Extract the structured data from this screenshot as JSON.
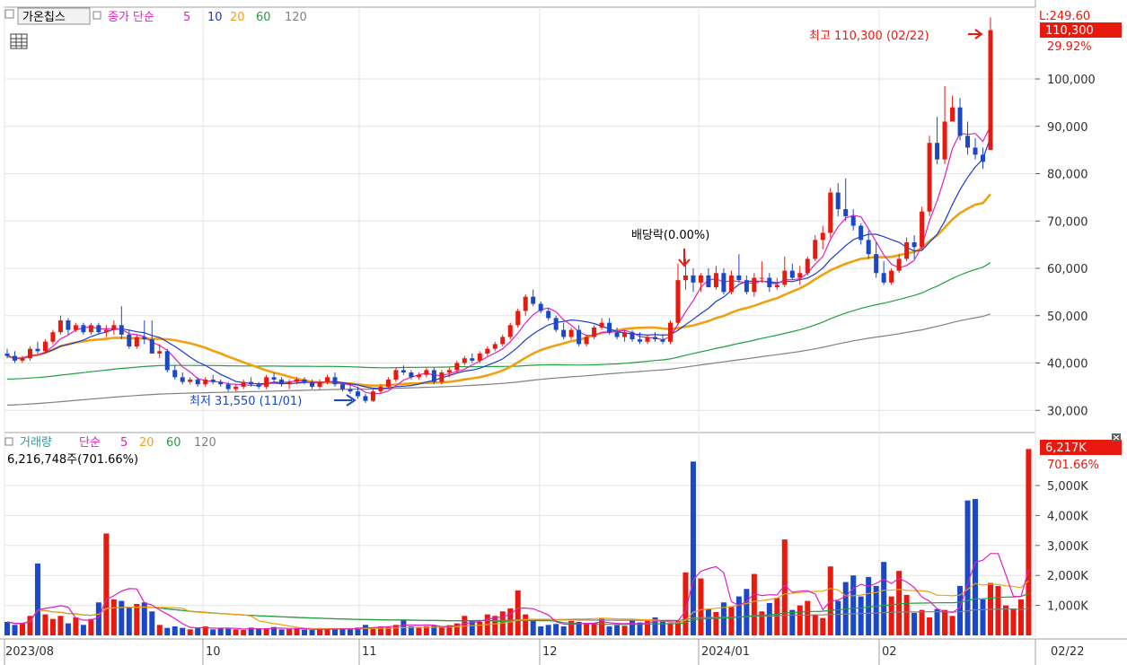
{
  "stock": {
    "name": "가온칩스",
    "ma_label": "종가 단순",
    "ma_periods": [
      "5",
      "10",
      "20",
      "60",
      "120"
    ]
  },
  "volume_panel": {
    "title": "거래량",
    "ma_label": "단순",
    "ma_periods": [
      "5",
      "20",
      "60",
      "120"
    ],
    "info": "6,216,748주(701.66%)"
  },
  "price_axis": {
    "ticks": [
      "100,000",
      "90,000",
      "80,000",
      "70,000",
      "60,000",
      "50,000",
      "40,000",
      "30,000"
    ],
    "top_partial": "L:249.60",
    "current_price": "110,300",
    "change_pct": "29.92%"
  },
  "volume_axis": {
    "ticks": [
      "5,000K",
      "4,000K",
      "3,000K",
      "2,000K",
      "1,000K"
    ],
    "current": "6,217K",
    "current_pct": "701.66%"
  },
  "x_axis": {
    "labels": [
      "2023/08",
      "10",
      "11",
      "12",
      "2024/01",
      "02"
    ],
    "last_date": "02/22"
  },
  "annotations": {
    "high": "최고 110,300 (02/22)",
    "low": "최저 31,550 (11/01)",
    "dividend": "배당락(0.00%)"
  },
  "colors": {
    "up": "#e8190f",
    "down": "#1a48c8",
    "ma5": "#e020c0",
    "ma10": "#1a3ad0",
    "ma20": "#f0a010",
    "ma60": "#20a040",
    "ma120": "#808080"
  },
  "chart_data": [
    {
      "type": "candlestick",
      "title": "가온칩스",
      "y_ticks": [
        30000,
        40000,
        50000,
        60000,
        70000,
        80000,
        90000,
        100000
      ],
      "ylim": [
        25000,
        113000
      ],
      "high": {
        "date": "02/22",
        "value": 110300
      },
      "low": {
        "date": "11/01",
        "value": 31550
      },
      "ohlc": [
        [
          42000,
          43000,
          41000,
          41500
        ],
        [
          41500,
          42500,
          40000,
          40500
        ],
        [
          40500,
          41500,
          40000,
          41000
        ],
        [
          41000,
          43500,
          40500,
          43000
        ],
        [
          43000,
          44500,
          42000,
          42500
        ],
        [
          42500,
          45000,
          42000,
          44500
        ],
        [
          44500,
          47000,
          44000,
          46500
        ],
        [
          46500,
          50000,
          46000,
          49000
        ],
        [
          49000,
          49500,
          46000,
          47000
        ],
        [
          47000,
          48500,
          46500,
          48000
        ],
        [
          48000,
          48500,
          46000,
          46500
        ],
        [
          46500,
          48500,
          46000,
          48000
        ],
        [
          48000,
          48500,
          46000,
          46500
        ],
        [
          46500,
          48000,
          45500,
          47000
        ],
        [
          47000,
          49000,
          46000,
          48000
        ],
        [
          48000,
          52000,
          45000,
          46000
        ],
        [
          46000,
          47000,
          43000,
          43500
        ],
        [
          43500,
          46000,
          43000,
          45500
        ],
        [
          45500,
          49000,
          44000,
          45000
        ],
        [
          45000,
          49000,
          44500,
          42000
        ],
        [
          42000,
          44000,
          41000,
          42500
        ],
        [
          42500,
          43000,
          38000,
          38500
        ],
        [
          38500,
          39500,
          36500,
          37000
        ],
        [
          37000,
          38000,
          35500,
          36000
        ],
        [
          36000,
          37000,
          35500,
          36500
        ],
        [
          36500,
          37000,
          35000,
          35500
        ],
        [
          35500,
          37000,
          35000,
          36500
        ],
        [
          36500,
          37500,
          35500,
          36000
        ],
        [
          36000,
          36500,
          35000,
          35500
        ],
        [
          35500,
          36000,
          34000,
          34500
        ],
        [
          34500,
          35500,
          34000,
          35000
        ],
        [
          35000,
          36500,
          34500,
          36000
        ],
        [
          36000,
          37000,
          35000,
          35500
        ],
        [
          35500,
          36000,
          34500,
          35000
        ],
        [
          35000,
          37500,
          34500,
          37000
        ],
        [
          37000,
          38000,
          36000,
          36500
        ],
        [
          36500,
          37000,
          35000,
          35500
        ],
        [
          35500,
          36500,
          34500,
          36000
        ],
        [
          36000,
          37000,
          35500,
          36500
        ],
        [
          36500,
          37000,
          35500,
          36000
        ],
        [
          36000,
          36500,
          34500,
          35000
        ],
        [
          35000,
          36500,
          34500,
          36000
        ],
        [
          36000,
          37500,
          35500,
          37000
        ],
        [
          37000,
          38000,
          35000,
          35500
        ],
        [
          35500,
          36000,
          34000,
          34500
        ],
        [
          34500,
          35500,
          33500,
          34000
        ],
        [
          34000,
          35000,
          32500,
          33000
        ],
        [
          33000,
          33500,
          31550,
          32000
        ],
        [
          32000,
          34500,
          31800,
          34000
        ],
        [
          34000,
          35500,
          33500,
          35000
        ],
        [
          35000,
          37000,
          34500,
          36500
        ],
        [
          36500,
          39000,
          36000,
          38500
        ],
        [
          38500,
          39500,
          37500,
          38000
        ],
        [
          38000,
          38500,
          36500,
          37000
        ],
        [
          37000,
          38000,
          36500,
          37500
        ],
        [
          37500,
          39000,
          37000,
          38500
        ],
        [
          38500,
          39000,
          35500,
          36000
        ],
        [
          36000,
          38500,
          35500,
          38000
        ],
        [
          38000,
          39000,
          37000,
          38500
        ],
        [
          38500,
          40500,
          38000,
          40000
        ],
        [
          40000,
          41500,
          39500,
          41000
        ],
        [
          41000,
          42000,
          40000,
          40500
        ],
        [
          40500,
          42500,
          40000,
          42000
        ],
        [
          42000,
          43500,
          41500,
          43000
        ],
        [
          43000,
          44500,
          42500,
          44000
        ],
        [
          44000,
          46000,
          43500,
          45500
        ],
        [
          45500,
          48500,
          45000,
          48000
        ],
        [
          48000,
          51500,
          47500,
          51000
        ],
        [
          51000,
          54500,
          50000,
          54000
        ],
        [
          54000,
          55500,
          52000,
          52500
        ],
        [
          52500,
          53000,
          50500,
          51000
        ],
        [
          51000,
          51500,
          49000,
          49500
        ],
        [
          49500,
          50000,
          46500,
          47000
        ],
        [
          47000,
          48500,
          45000,
          45500
        ],
        [
          45500,
          47500,
          45000,
          47000
        ],
        [
          47000,
          48000,
          43500,
          44000
        ],
        [
          44000,
          46000,
          43500,
          45500
        ],
        [
          45500,
          48000,
          45000,
          47500
        ],
        [
          47500,
          49500,
          47000,
          48500
        ],
        [
          48500,
          49500,
          46000,
          46500
        ],
        [
          46500,
          47500,
          45000,
          45500
        ],
        [
          45500,
          47000,
          44500,
          46500
        ],
        [
          46500,
          47000,
          44500,
          45000
        ],
        [
          45000,
          46500,
          44000,
          44500
        ],
        [
          44500,
          46000,
          44000,
          45500
        ],
        [
          45500,
          46500,
          44500,
          45000
        ],
        [
          45000,
          46000,
          44000,
          44500
        ],
        [
          44500,
          49000,
          44000,
          48500
        ],
        [
          48500,
          61000,
          48000,
          57500
        ],
        [
          57500,
          62000,
          55500,
          58500
        ],
        [
          58500,
          60000,
          55000,
          57000
        ],
        [
          57000,
          59000,
          55000,
          58500
        ],
        [
          58500,
          60000,
          56000,
          56000
        ],
        [
          56000,
          60500,
          55500,
          59000
        ],
        [
          59000,
          60000,
          54500,
          55000
        ],
        [
          55000,
          59500,
          54500,
          58500
        ],
        [
          58500,
          63000,
          57000,
          57500
        ],
        [
          57500,
          58500,
          54500,
          55000
        ],
        [
          55000,
          59000,
          54000,
          58000
        ],
        [
          58000,
          61500,
          57000,
          58000
        ],
        [
          58000,
          59000,
          55000,
          56000
        ],
        [
          56000,
          58000,
          55500,
          56500
        ],
        [
          56500,
          62500,
          56000,
          59500
        ],
        [
          59500,
          61000,
          57500,
          58000
        ],
        [
          58000,
          60500,
          56500,
          59000
        ],
        [
          59000,
          62500,
          58500,
          62000
        ],
        [
          62000,
          67000,
          61500,
          66000
        ],
        [
          66000,
          69000,
          64000,
          67500
        ],
        [
          67500,
          77000,
          66500,
          76000
        ],
        [
          76000,
          78000,
          71000,
          72500
        ],
        [
          72500,
          79000,
          70000,
          71000
        ],
        [
          71000,
          72500,
          68000,
          69000
        ],
        [
          69000,
          69500,
          65000,
          66000
        ],
        [
          66000,
          68000,
          62000,
          63000
        ],
        [
          63000,
          65500,
          58000,
          59000
        ],
        [
          59000,
          61500,
          56500,
          57000
        ],
        [
          57000,
          60000,
          56500,
          59500
        ],
        [
          59500,
          63000,
          59000,
          62000
        ],
        [
          62000,
          66500,
          61500,
          65500
        ],
        [
          65500,
          67000,
          62000,
          64500
        ],
        [
          64500,
          73000,
          64000,
          72000
        ],
        [
          72000,
          88000,
          71000,
          86500
        ],
        [
          86500,
          92000,
          82000,
          83000
        ],
        [
          83000,
          98500,
          82000,
          91000
        ],
        [
          91000,
          96500,
          91000,
          94000
        ],
        [
          94000,
          96000,
          87000,
          88000
        ],
        [
          88000,
          91000,
          84000,
          85500
        ],
        [
          85500,
          87500,
          83000,
          84000
        ],
        [
          84000,
          85500,
          81000,
          82500
        ],
        [
          85000,
          113000,
          85000,
          110300
        ]
      ]
    },
    {
      "type": "bar",
      "title": "거래량",
      "y_ticks": [
        1000,
        2000,
        3000,
        4000,
        5000
      ],
      "y_unit": "K",
      "ylim": [
        0,
        6400
      ],
      "latest": {
        "value": 6216748,
        "pct": 701.66
      },
      "values_k": [
        450,
        350,
        400,
        650,
        2400,
        700,
        550,
        650,
        400,
        600,
        350,
        550,
        1100,
        3400,
        1200,
        1150,
        950,
        1050,
        1100,
        800,
        350,
        250,
        300,
        250,
        200,
        250,
        300,
        200,
        250,
        220,
        200,
        180,
        260,
        230,
        240,
        280,
        200,
        210,
        230,
        190,
        180,
        200,
        220,
        240,
        220,
        200,
        260,
        350,
        260,
        300,
        280,
        350,
        500,
        300,
        280,
        300,
        320,
        260,
        340,
        400,
        650,
        500,
        450,
        700,
        650,
        800,
        900,
        1500,
        700,
        550,
        300,
        350,
        380,
        300,
        480,
        450,
        380,
        420,
        560,
        300,
        340,
        320,
        500,
        430,
        480,
        600,
        460,
        410,
        480,
        2100,
        5800,
        1900,
        880,
        780,
        1100,
        950,
        1300,
        1550,
        2050,
        800,
        1080,
        1250,
        3200,
        850,
        1000,
        1150,
        700,
        580,
        2300,
        1150,
        1780,
        2000,
        1300,
        1950,
        1650,
        2450,
        1300,
        2150,
        1350,
        750,
        850,
        600,
        880,
        850,
        650,
        1650,
        4500,
        4550,
        1200,
        1750,
        1650,
        1000,
        900,
        1200,
        6217
      ]
    }
  ]
}
